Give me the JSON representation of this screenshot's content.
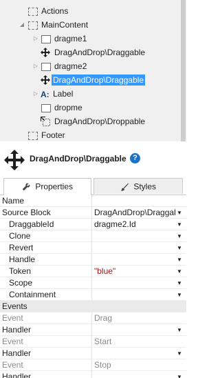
{
  "tree": {
    "nodes": [
      {
        "label": "Actions",
        "icon": "container-icon"
      },
      {
        "label": "MainContent",
        "icon": "container-icon",
        "expander": "expanded"
      },
      {
        "label": "dragme1",
        "icon": "container-icon",
        "expander": "collapsed"
      },
      {
        "label": "DragAndDrop\\Draggable",
        "icon": "move-icon"
      },
      {
        "label": "dragme2",
        "icon": "container-icon",
        "expander": "collapsed"
      },
      {
        "label": "DragAndDrop\\Draggable",
        "icon": "move-icon",
        "selected": true
      },
      {
        "label": "Label",
        "icon": "label-icon",
        "expander": "collapsed"
      },
      {
        "label": "dropme",
        "icon": "container-icon"
      },
      {
        "label": "DragAndDrop\\Droppable",
        "icon": "droppable-icon"
      },
      {
        "label": "Footer",
        "icon": "container-icon"
      }
    ]
  },
  "header": {
    "title": "DragAndDrop\\Draggable",
    "help_glyph": "?"
  },
  "tabs": [
    {
      "label": "Properties",
      "icon": "wrench-icon",
      "active": true
    },
    {
      "label": "Styles",
      "icon": "brush-icon",
      "active": false
    }
  ],
  "properties": {
    "rows": [
      {
        "name": "Name",
        "value": ""
      },
      {
        "name": "Source Block",
        "value": "DragAndDrop\\Draggable",
        "dropdown": true
      },
      {
        "name": "DraggableId",
        "value": "dragme2.Id",
        "dropdown": true,
        "child": true
      },
      {
        "name": "Clone",
        "value": "",
        "dropdown": true,
        "child": true
      },
      {
        "name": "Revert",
        "value": "",
        "dropdown": true,
        "child": true
      },
      {
        "name": "Handle",
        "value": "",
        "dropdown": true,
        "child": true
      },
      {
        "name": "Token",
        "value": "\"blue\"",
        "dropdown": true,
        "child": true,
        "red": true
      },
      {
        "name": "Scope",
        "value": "",
        "dropdown": true,
        "child": true
      },
      {
        "name": "Containment",
        "value": "",
        "dropdown": true,
        "child": true
      }
    ],
    "events_header": "Events",
    "events": [
      {
        "event_label": "Event",
        "event_name": "Drag",
        "handler_label": "Handler"
      },
      {
        "event_label": "Event",
        "event_name": "Start",
        "handler_label": "Handler"
      },
      {
        "event_label": "Event",
        "event_name": "Stop",
        "handler_label": "Handler"
      }
    ]
  },
  "colors": {
    "selection": "#3399ff",
    "help": "#1a73c9",
    "string_value": "#a31515"
  }
}
